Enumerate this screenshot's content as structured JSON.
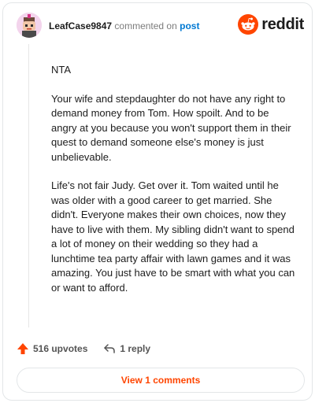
{
  "header": {
    "username": "LeafCase9847",
    "commented_on": "commented on",
    "post_link": "post",
    "logo_text": "reddit"
  },
  "comment": {
    "paragraphs": [
      "NTA",
      "Your wife and stepdaughter do not have any right to demand money from Tom. How spoilt. And to be angry at you because you won't support them in their quest to demand someone else's money is just unbelievable.",
      "Life's not fair Judy. Get over it. Tom waited until he was older with a good career to get married. She didn't. Everyone makes their own choices, now they have to live with them. My sibling didn't want to spend a lot of money on their wedding so they had a lunchtime tea party affair with lawn games and it was amazing. You just have to be smart with what you can or want to afford."
    ]
  },
  "actions": {
    "upvotes": "516 upvotes",
    "replies": "1 reply"
  },
  "view_button": "View 1 comments",
  "colors": {
    "accent": "#ff4500",
    "link": "#0079d3"
  }
}
